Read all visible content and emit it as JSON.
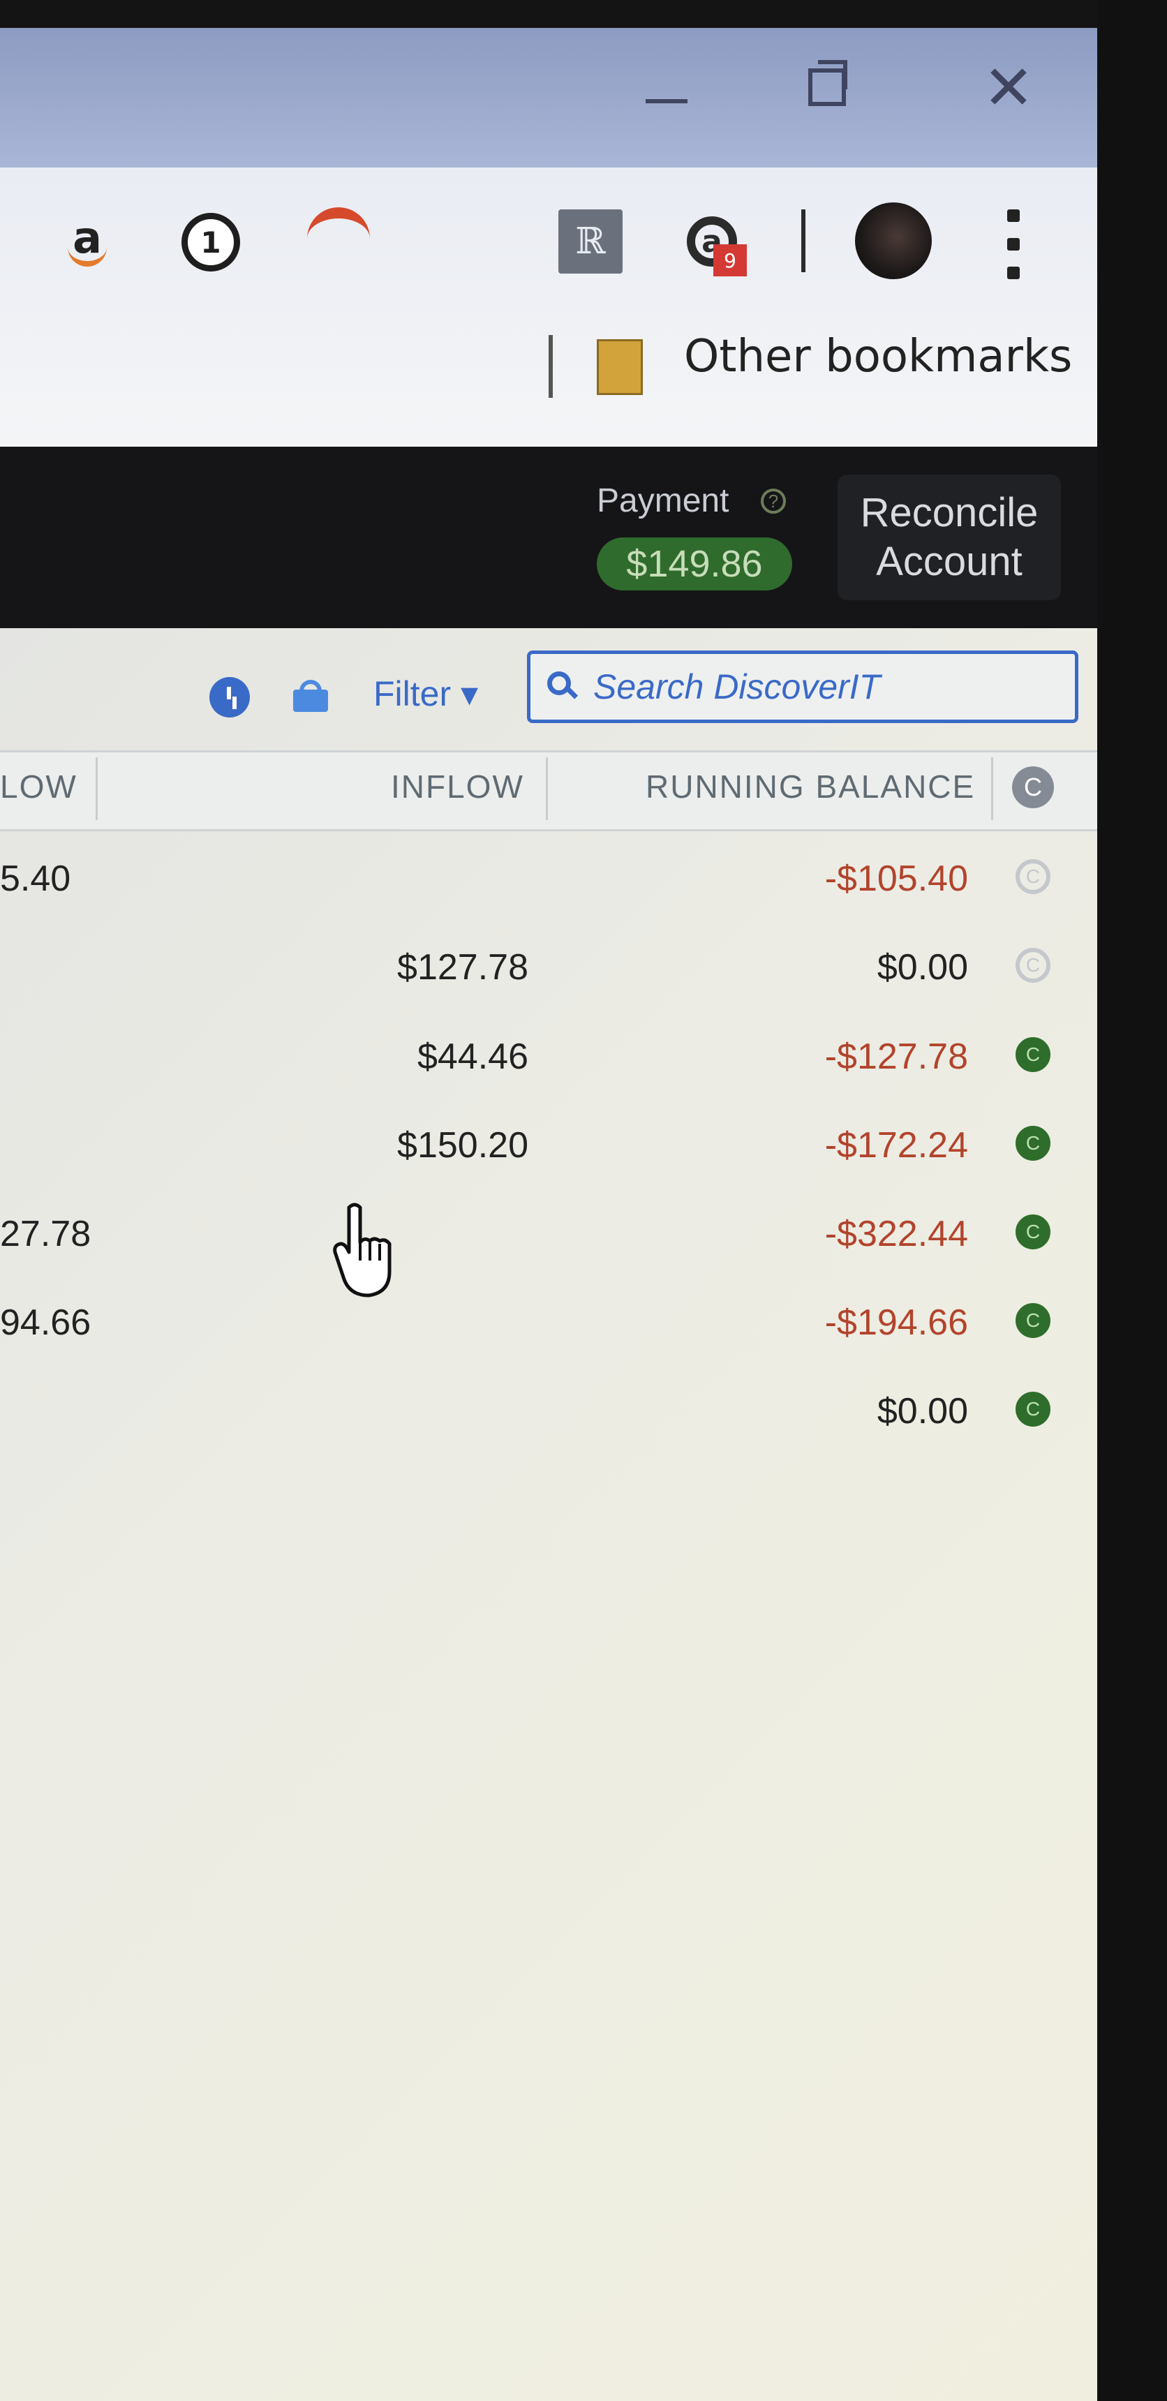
{
  "browser": {
    "window_controls": {
      "minimize": "—",
      "restore": "❐",
      "close": "✕"
    },
    "extension_badge": "9",
    "bookmarks": {
      "other_bookmarks_label": "Other bookmarks"
    }
  },
  "header": {
    "payment_label": "Payment",
    "payment_help": "?",
    "payment_amount": "$149.86",
    "reconcile_label": "Reconcile Account"
  },
  "toolbar": {
    "filter_label": "Filter ▾",
    "search_placeholder": "Search DiscoverIT"
  },
  "columns": {
    "outflow": "LOW",
    "inflow": "INFLOW",
    "running_balance": "RUNNING BALANCE",
    "cleared_icon": "C"
  },
  "rows": [
    {
      "outflow": "5.40",
      "inflow": "",
      "balance": "-$105.40",
      "status": "uncleared",
      "status_icon": "C"
    },
    {
      "outflow": "",
      "inflow": "$127.78",
      "balance": "$0.00",
      "status": "uncleared",
      "status_icon": "C"
    },
    {
      "outflow": "",
      "inflow": "$44.46",
      "balance": "-$127.78",
      "status": "cleared",
      "status_icon": "C"
    },
    {
      "outflow": "",
      "inflow": "$150.20",
      "balance": "-$172.24",
      "status": "cleared",
      "status_icon": "C"
    },
    {
      "outflow": "27.78",
      "inflow": "",
      "balance": "-$322.44",
      "status": "cleared",
      "status_icon": "C"
    },
    {
      "outflow": "94.66",
      "inflow": "",
      "balance": "-$194.66",
      "status": "cleared",
      "status_icon": "C"
    },
    {
      "outflow": "",
      "inflow": "",
      "balance": "$0.00",
      "status": "cleared",
      "status_icon": "C"
    }
  ],
  "colors": {
    "accent_blue": "#3a6ac7",
    "cleared_green": "#2e6d2b",
    "payment_green": "#2f6b2d",
    "negative_red": "#b2442c",
    "header_dark": "#151517"
  },
  "icons": [
    "amazon-assistant-icon",
    "onepassword-icon",
    "arc-extension-icon",
    "r-extension-icon",
    "a-extension-icon",
    "avatar",
    "menu-dots-icon",
    "folder-icon",
    "clock-icon",
    "lock-icon",
    "search-icon",
    "hand-cursor-icon"
  ]
}
